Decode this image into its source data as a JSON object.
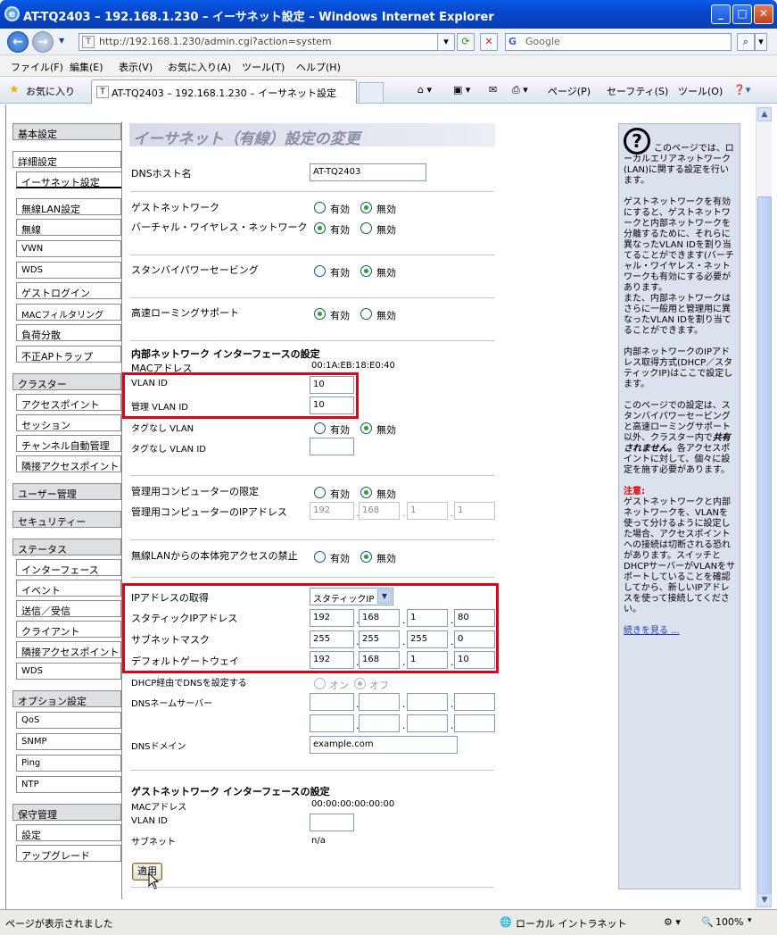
{
  "window": {
    "title": "AT-TQ2403 – 192.168.1.230 – イーサネット設定 – Windows Internet Explorer"
  },
  "browser": {
    "address": "http://192.168.1.230/admin.cgi?action=system",
    "search_placeholder": "Google",
    "menu": [
      "ファイル(F)",
      "編集(E)",
      "表示(V)",
      "お気に入り(A)",
      "ツール(T)",
      "ヘルプ(H)"
    ],
    "favorites_label": "お気に入り",
    "tab_title": "AT-TQ2403 – 192.168.1.230 – イーサネット設定",
    "tools": {
      "page": "ページ(P)",
      "safety": "セーフティ(S)",
      "tools": "ツール(O)"
    }
  },
  "nav": {
    "basic": "基本設定",
    "advanced": "詳細設定",
    "ethernet": "イーサネット設定",
    "wlan": "無線LAN設定",
    "wireless": "無線",
    "vwn": "VWN",
    "wds": "WDS",
    "guest_login": "ゲストログイン",
    "mac_filter": "MACフィルタリング",
    "load_balance": "負荷分散",
    "rogue_ap": "不正APトラップ",
    "cluster": "クラスター",
    "access_points": "アクセスポイント",
    "session": "セッション",
    "auto_channel": "チャンネル自動管理",
    "neighbor_ap": "隣接アクセスポイント",
    "user_mgmt": "ユーザー管理",
    "security": "セキュリティー",
    "status": "ステータス",
    "interfaces": "インターフェース",
    "events": "イベント",
    "tx_rx": "送信／受信",
    "clients": "クライアント",
    "neighbor_ap2": "隣接アクセスポイント",
    "wds2": "WDS",
    "options": "オプション設定",
    "qos": "QoS",
    "snmp": "SNMP",
    "ping": "Ping",
    "ntp": "NTP",
    "maintenance": "保守管理",
    "settings": "設定",
    "upgrade": "アップグレード"
  },
  "main": {
    "title": "イーサネット（有線）設定の変更",
    "dns_host_label": "DNSホスト名",
    "dns_host_value": "AT-TQ2403",
    "guest_network_label": "ゲストネットワーク",
    "virtual_wireless_label": "バーチャル・ワイヤレス・ネットワーク",
    "standby_label": "スタンバイパワーセービング",
    "fast_roaming_label": "高速ローミングサポート",
    "enabled": "有効",
    "disabled": "無効",
    "internal_header": "内部ネットワーク インターフェースの設定",
    "mac_label": "MACアドレス",
    "mac_value": "00:1A:EB:18:E0:40",
    "vlan_id_label": "VLAN ID",
    "vlan_id_value": "10",
    "mgmt_vlan_label": "管理 VLAN ID",
    "mgmt_vlan_value": "10",
    "untagged_label": "タグなし VLAN",
    "untagged_id_label": "タグなし VLAN ID",
    "untagged_id_value": "",
    "mgmt_pc_limit_label": "管理用コンピューターの限定",
    "mgmt_pc_ip_label": "管理用コンピューターのIPアドレス",
    "mgmt_pc_ip": [
      "192",
      "168",
      "1",
      "1"
    ],
    "wireless_access_label": "無線LANからの本体宛アクセスの禁止",
    "ip_acquire_label": "IPアドレスの取得",
    "ip_acquire_value": "スタティックIP",
    "static_ip_label": "スタティックIPアドレス",
    "static_ip": [
      "192",
      "168",
      "1",
      "80"
    ],
    "subnet_label": "サブネットマスク",
    "subnet": [
      "255",
      "255",
      "255",
      "0"
    ],
    "gateway_label": "デフォルトゲートウェイ",
    "gateway": [
      "192",
      "168",
      "1",
      "10"
    ],
    "dhcp_dns_label": "DHCP経由でDNSを設定する",
    "on": "オン",
    "off": "オフ",
    "dns_server_label": "DNSネームサーバー",
    "dns_domain_label": "DNSドメイン",
    "dns_domain_value": "example.com",
    "guest_header": "ゲストネットワーク インターフェースの設定",
    "guest_mac_label": "MACアドレス",
    "guest_mac_value": "00:00:00:00:00:00",
    "guest_vlan_label": "VLAN ID",
    "guest_vlan_value": "",
    "guest_subnet_label": "サブネット",
    "guest_subnet_value": "n/a",
    "apply_button": "適用"
  },
  "help": {
    "p1": "このページでは、ローカルエリアネットワーク(LAN)に関する設定を行います。",
    "p2": "ゲストネットワークを有効にすると、ゲストネットワークと内部ネットワークを分離するために、それらに異なったVLAN IDを割り当てることができます(バーチャル・ワイヤレス・ネットワークも有効にする必要があります。",
    "p2b": "また、内部ネットワークはさらに一般用と管理用に異なったVLAN IDを割り当てることができます。",
    "p3": "内部ネットワークのIPアドレス取得方式(DHCP／スタティックIP)はここで設定します。",
    "p4a": "このページでの設定は、スタンバイパワーセービングと高速ローミングサポート以外、クラスター内で",
    "p4b": "共有されません。",
    "p4c": "各アクセスポイントに対して、個々に設定を施す必要があります。",
    "warn_title": "注意:",
    "p5": "ゲストネットワークと内部ネットワークを、VLANを使って分けるように設定した場合、アクセスポイントへの接続は切断される恐れがあります。スイッチとDHCPサーバーがVLANをサポートしていることを確認してから、新しいIPアドレスを使って接続してください。",
    "more_link": "続きを見る ..."
  },
  "statusbar": {
    "text": "ページが表示されました",
    "zone": "ローカル イントラネット",
    "zoom": "100%"
  }
}
